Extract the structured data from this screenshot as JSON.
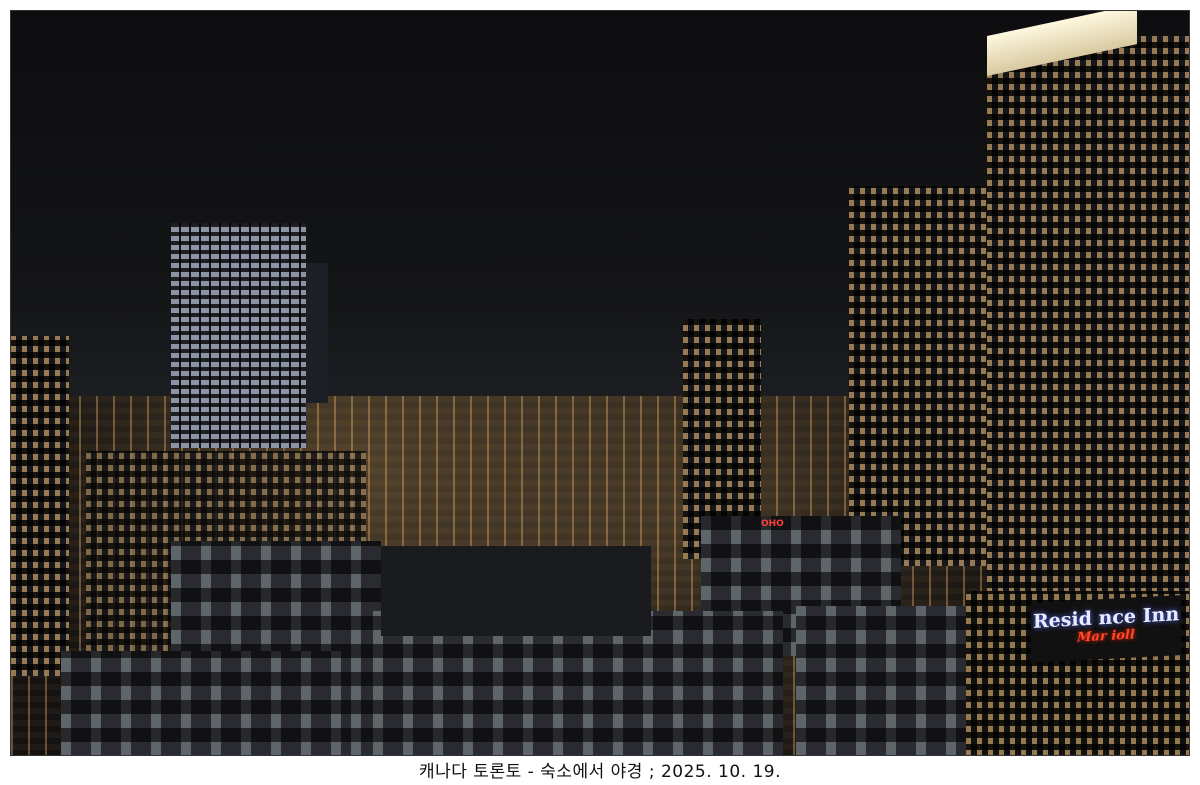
{
  "photo": {
    "subject": "Toronto night skyline",
    "sign_main": "Resid  nce Inn",
    "sign_sub": "Mar  ioll",
    "rooftop_sign": "OHO"
  },
  "caption": "캐나다 토론토 - 숙소에서 야경 ; 2025. 10. 19."
}
